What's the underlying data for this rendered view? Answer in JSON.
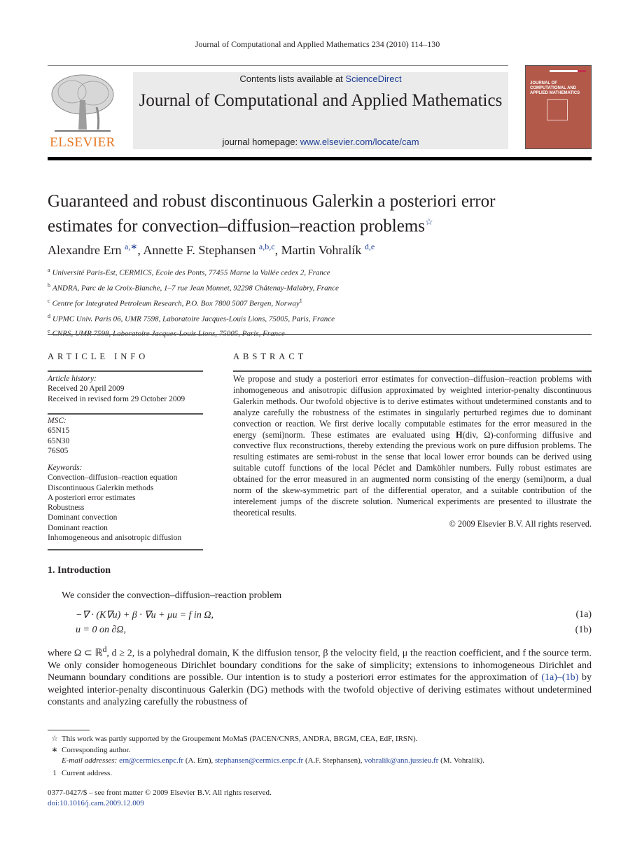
{
  "running_head": "Journal of Computational and Applied Mathematics 234 (2010) 114–130",
  "banner": {
    "contents_prefix": "Contents lists available at ",
    "contents_link": "ScienceDirect",
    "journal_title": "Journal of Computational and Applied Mathematics",
    "homepage_prefix": "journal homepage: ",
    "homepage_link": "www.elsevier.com/locate/cam"
  },
  "publisher_logo_text": "ELSEVIER",
  "cover_title": "JOURNAL OF COMPUTATIONAL AND APPLIED MATHEMATICS",
  "article": {
    "title_line1": "Guaranteed and robust discontinuous Galerkin a posteriori error",
    "title_line2": "estimates for convection–diffusion–reaction problems",
    "title_mark": "☆",
    "authors": [
      {
        "name": "Alexandre Ern",
        "sup": "a,∗"
      },
      {
        "name": "Annette F. Stephansen",
        "sup": "a,b,c"
      },
      {
        "name": "Martin Vohralík",
        "sup": "d,e"
      }
    ],
    "affiliations": [
      {
        "mark": "a",
        "text": "Université Paris-Est, CERMICS, Ecole des Ponts, 77455 Marne la Vallée cedex 2, France"
      },
      {
        "mark": "b",
        "text": "ANDRA, Parc de la Croix-Blanche, 1–7 rue Jean Monnet, 92298 Châtenay-Malabry, France"
      },
      {
        "mark": "c",
        "text": "Centre for Integrated Petroleum Research, P.O. Box 7800 5007 Bergen, Norway",
        "note": "1"
      },
      {
        "mark": "d",
        "text": "UPMC Univ. Paris 06, UMR 7598, Laboratoire Jacques-Louis Lions, 75005, Paris, France"
      },
      {
        "mark": "e",
        "text": "CNRS, UMR 7598, Laboratoire Jacques-Louis Lions, 75005, Paris, France"
      }
    ]
  },
  "article_info": {
    "heading": "ARTICLE INFO",
    "history_label": "Article history:",
    "history": [
      "Received 20 April 2009",
      "Received in revised form 29 October 2009"
    ],
    "msc_label": "MSC:",
    "msc": [
      "65N15",
      "65N30",
      "76S05"
    ],
    "keywords_label": "Keywords:",
    "keywords": [
      "Convection–diffusion–reaction equation",
      "Discontinuous Galerkin methods",
      "A posteriori error estimates",
      "Robustness",
      "Dominant convection",
      "Dominant reaction",
      "Inhomogeneous and anisotropic diffusion"
    ]
  },
  "abstract": {
    "heading": "ABSTRACT",
    "text_before_H": "We propose and study a posteriori error estimates for convection–diffusion–reaction problems with inhomogeneous and anisotropic diffusion approximated by weighted interior-penalty discontinuous Galerkin methods. Our twofold objective is to derive estimates without undetermined constants and to analyze carefully the robustness of the estimates in singularly perturbed regimes due to dominant convection or reaction. We first derive locally computable estimates for the error measured in the energy (semi)norm. These estimates are evaluated using ",
    "H_bold": "H",
    "H_args": "(div, Ω)",
    "text_after_H": "-conforming diffusive and convective flux reconstructions, thereby extending the previous work on pure diffusion problems. The resulting estimates are semi-robust in the sense that local lower error bounds can be derived using suitable cutoff functions of the local Péclet and Damköhler numbers. Fully robust estimates are obtained for the error measured in an augmented norm consisting of the energy (semi)norm, a dual norm of the skew-symmetric part of the differential operator, and a suitable contribution of the interelement jumps of the discrete solution. Numerical experiments are presented to illustrate the theoretical results.",
    "copyright": "© 2009 Elsevier B.V. All rights reserved."
  },
  "introduction": {
    "heading": "1.  Introduction",
    "lead": "We consider the convection–diffusion–reaction problem",
    "equations": [
      {
        "expr": "−∇ · (K∇u) + β · ∇u + μu = f     in Ω,",
        "label": "(1a)"
      },
      {
        "expr": "u = 0     on ∂Ω,",
        "label": "(1b)"
      }
    ],
    "para_start": "where Ω ⊂ ℝ",
    "para_sup": "d",
    "para_mid": ", d ≥ 2, is a polyhedral domain, K the diffusion tensor, β the velocity field, μ the reaction coefficient, and f the source term. We only consider homogeneous Dirichlet boundary conditions for the sake of simplicity; extensions to inhomogeneous Dirichlet and Neumann boundary conditions are possible. Our intention is to study a posteriori error estimates for the approximation of ",
    "para_ref": "(1a)–(1b)",
    "para_end": " by weighted interior-penalty discontinuous Galerkin (DG) methods with the twofold objective of deriving estimates without undetermined constants and analyzing carefully the robustness of"
  },
  "footnotes": [
    {
      "mark": "☆",
      "text": "This work was partly supported by the Groupement MoMaS (PACEN/CNRS, ANDRA, BRGM, CEA, EdF, IRSN)."
    },
    {
      "mark": "∗",
      "text": "Corresponding author."
    },
    {
      "mark": "1",
      "text": "Current address."
    }
  ],
  "emails": {
    "label": "E-mail addresses:",
    "items": [
      {
        "email": "ern@cermics.enpc.fr",
        "who": " (A. Ern), "
      },
      {
        "email": "stephansen@cermics.enpc.fr",
        "who": " (A.F. Stephansen), "
      },
      {
        "email": "vohralik@ann.jussieu.fr",
        "who": " (M. Vohralík)."
      }
    ]
  },
  "front_matter": "0377-0427/$ – see front matter © 2009 Elsevier B.V. All rights reserved.",
  "doi": "doi:10.1016/j.cam.2009.12.009"
}
